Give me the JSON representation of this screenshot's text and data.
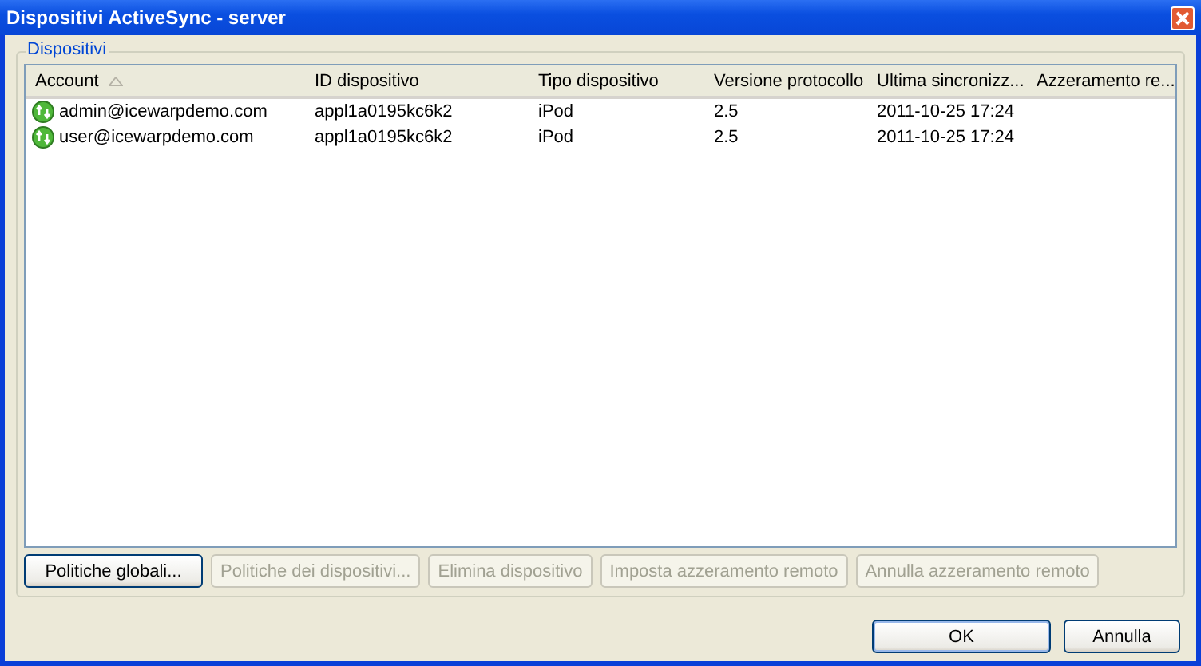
{
  "window": {
    "title": "Dispositivi ActiveSync -  server"
  },
  "group": {
    "label": "Dispositivi"
  },
  "table": {
    "columns": [
      {
        "label": "Account",
        "sorted": true
      },
      {
        "label": "ID dispositivo"
      },
      {
        "label": "Tipo dispositivo"
      },
      {
        "label": "Versione protocollo"
      },
      {
        "label": "Ultima sincronizz..."
      },
      {
        "label": "Azzeramento re..."
      }
    ],
    "rows": [
      {
        "cells": [
          "admin@icewarpdemo.com",
          "appl1a0195kc6k2",
          "iPod",
          "2.5",
          "2011-10-25 17:24"
        ]
      },
      {
        "cells": [
          "user@icewarpdemo.com",
          "appl1a0195kc6k2",
          "iPod",
          "2.5",
          "2011-10-25 17:24"
        ]
      }
    ]
  },
  "actions": [
    {
      "label": "Politiche globali...",
      "disabled": false
    },
    {
      "label": "Politiche dei dispositivi...",
      "disabled": true
    },
    {
      "label": "Elimina dispositivo",
      "disabled": true
    },
    {
      "label": "Imposta azzeramento remoto",
      "disabled": true
    },
    {
      "label": "Annulla azzeramento remoto",
      "disabled": true
    }
  ],
  "dialog_buttons": [
    {
      "label": "OK",
      "default": true
    },
    {
      "label": "Annulla",
      "default": false
    }
  ]
}
